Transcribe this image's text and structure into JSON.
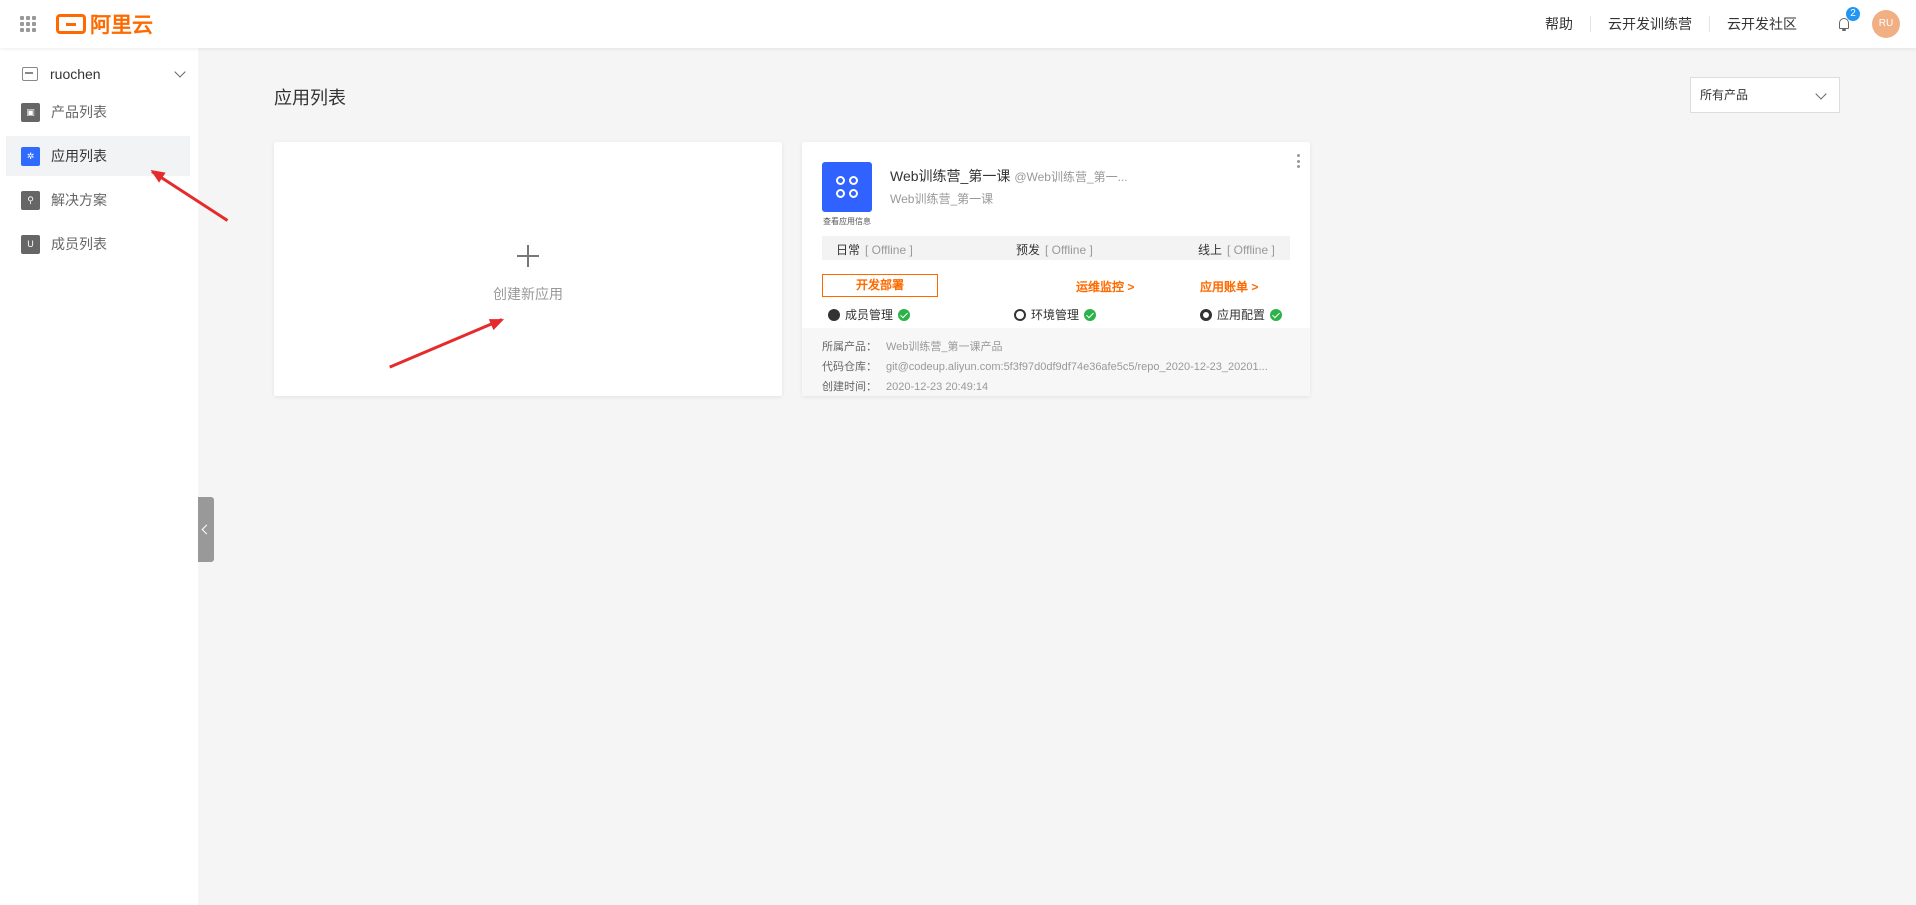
{
  "header": {
    "logo_text": "阿里云",
    "links": [
      "帮助",
      "云开发训练营",
      "云开发社区"
    ],
    "notification_count": "2",
    "avatar_initials": "RU"
  },
  "sidebar": {
    "team_name": "ruochen",
    "items": [
      {
        "label": "产品列表",
        "icon": "product-icon"
      },
      {
        "label": "应用列表",
        "icon": "app-icon",
        "active": true
      },
      {
        "label": "解决方案",
        "icon": "solution-icon"
      },
      {
        "label": "成员列表",
        "icon": "member-icon"
      }
    ]
  },
  "main": {
    "title": "应用列表",
    "filter_value": "所有产品",
    "create_card": {
      "label": "创建新应用"
    },
    "app_card": {
      "name": "Web训练营_第一课",
      "alias": "@Web训练营_第一...",
      "subtitle": "Web训练营_第一课",
      "info_link": "查看应用信息",
      "envs": [
        {
          "name": "日常",
          "status": "[ Offline ]"
        },
        {
          "name": "预发",
          "status": "[ Offline ]"
        },
        {
          "name": "线上",
          "status": "[ Offline ]"
        }
      ],
      "deploy_label": "开发部署",
      "monitor_label": "运维监控 >",
      "billing_label": "应用账单 >",
      "member_mgmt": "成员管理",
      "env_mgmt": "环境管理",
      "app_config": "应用配置",
      "meta": [
        {
          "key": "所属产品：",
          "value": "Web训练营_第一课产品"
        },
        {
          "key": "代码仓库：",
          "value": "git@codeup.aliyun.com:5f3f97d0df9df74e36afe5c5/repo_2020-12-23_20201..."
        },
        {
          "key": "创建时间：",
          "value": "2020-12-23 20:49:14"
        }
      ]
    }
  },
  "colors": {
    "accent": "#ff6a00",
    "primary_blue": "#2f62ff",
    "success": "#2bb34a",
    "annotation_red": "#e52b2b"
  }
}
